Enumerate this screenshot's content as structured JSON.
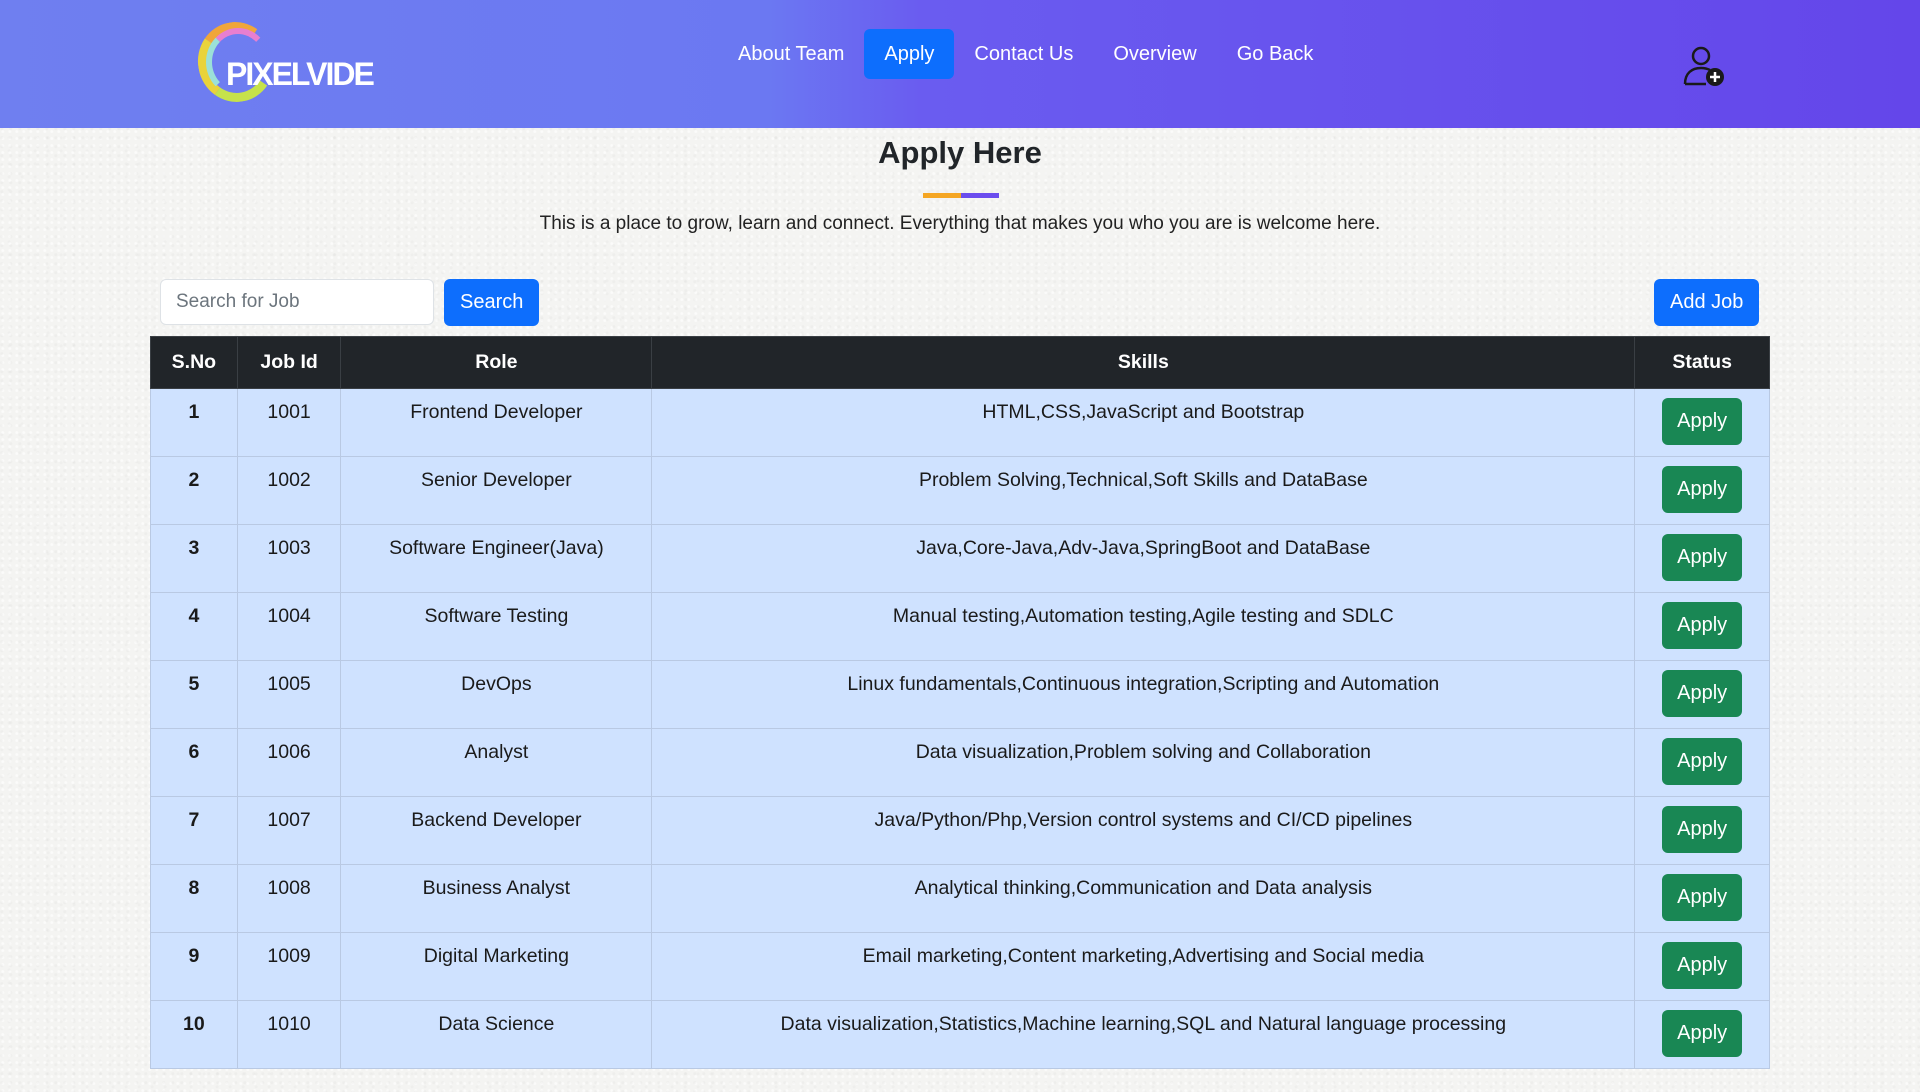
{
  "brand": {
    "logo_text": "PIXELVIDE"
  },
  "nav": {
    "items": [
      {
        "label": "About Team"
      },
      {
        "label": "Apply",
        "active": true
      },
      {
        "label": "Contact Us"
      },
      {
        "label": "Overview"
      },
      {
        "label": "Go Back"
      }
    ],
    "user_icon": "add-user-icon"
  },
  "page": {
    "title": "Apply Here",
    "subtitle": "This is a place to grow, learn and connect. Everything that makes you who you are is welcome here."
  },
  "toolbar": {
    "search_placeholder": "Search for Job",
    "search_value": "",
    "search_label": "Search",
    "add_job_label": "Add Job"
  },
  "table": {
    "headers": [
      "S.No",
      "Job Id",
      "Role",
      "Skills",
      "Status"
    ],
    "rows": [
      {
        "sno": "1",
        "id": "1001",
        "role": "Frontend Developer",
        "skills": "HTML,CSS,JavaScript and Bootstrap",
        "action": "Apply"
      },
      {
        "sno": "2",
        "id": "1002",
        "role": "Senior Developer",
        "skills": "Problem Solving,Technical,Soft Skills and DataBase",
        "action": "Apply"
      },
      {
        "sno": "3",
        "id": "1003",
        "role": "Software Engineer(Java)",
        "skills": "Java,Core-Java,Adv-Java,SpringBoot and DataBase",
        "action": "Apply"
      },
      {
        "sno": "4",
        "id": "1004",
        "role": "Software Testing",
        "skills": "Manual testing,Automation testing,Agile testing and SDLC",
        "action": "Apply"
      },
      {
        "sno": "5",
        "id": "1005",
        "role": "DevOps",
        "skills": "Linux fundamentals,Continuous integration,Scripting and Automation",
        "action": "Apply"
      },
      {
        "sno": "6",
        "id": "1006",
        "role": "Analyst",
        "skills": "Data visualization,Problem solving and Collaboration",
        "action": "Apply"
      },
      {
        "sno": "7",
        "id": "1007",
        "role": "Backend Developer",
        "skills": "Java/Python/Php,Version control systems and CI/CD pipelines",
        "action": "Apply"
      },
      {
        "sno": "8",
        "id": "1008",
        "role": "Business Analyst",
        "skills": "Analytical thinking,Communication and Data analysis",
        "action": "Apply"
      },
      {
        "sno": "9",
        "id": "1009",
        "role": "Digital Marketing",
        "skills": "Email marketing,Content marketing,Advertising and Social media",
        "action": "Apply"
      },
      {
        "sno": "10",
        "id": "1010",
        "role": "Data Science",
        "skills": "Data visualization,Statistics,Machine learning,SQL and Natural language processing",
        "action": "Apply"
      }
    ]
  },
  "colors": {
    "header_gradient_start": "#6f7ff0",
    "header_gradient_end": "#6446ea",
    "primary": "#0d6efd",
    "success": "#198754",
    "table_header": "#212529",
    "table_row": "#cfe2ff",
    "underline_orange": "#f5a623",
    "underline_purple": "#6a4cee"
  }
}
